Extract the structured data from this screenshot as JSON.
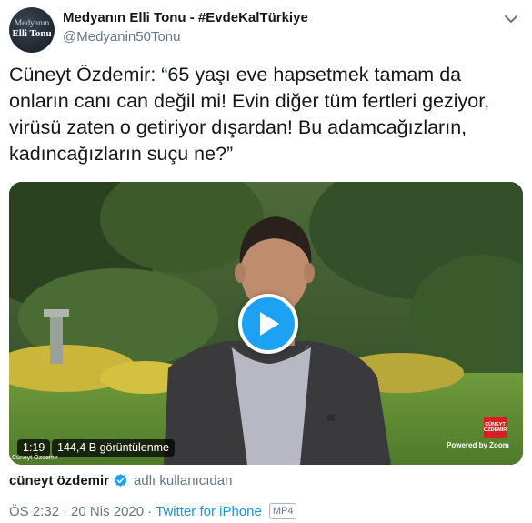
{
  "header": {
    "avatar": {
      "line1": "Medyanın",
      "line2": "Elli Tonu"
    },
    "display_name": "Medyanın Elli Tonu - #EvdeKalTürkiye",
    "handle": "@Medyanin50Tonu",
    "menu_icon": "chevron-down-icon"
  },
  "tweet": {
    "text": "Cüneyt Özdemir: “65 yaşı eve hapsetmek tamam da onların canı can değil mi! Evin diğer tüm fertleri geziyor, virüsü zaten o getiriyor dışardan! Bu adamcağızların, kadıncağızların suçu ne?”"
  },
  "video": {
    "duration": "1:19",
    "views": "144,4 B görüntülenme",
    "watermark_name": "Cüneyt Özdemir",
    "logo_text": "CÜNEYT ÖZDEMİR",
    "powered_by": "Powered by Zoom",
    "play_icon": "play-icon",
    "colors": {
      "play_button": "#1da1f2"
    }
  },
  "source": {
    "name": "cüneyt özdemir",
    "verified_icon": "verified-badge-icon",
    "suffix": "adlı kullanıcıdan"
  },
  "meta": {
    "time": "ÖS 2:32",
    "date": "20 Nis 2020",
    "client": "Twitter for iPhone",
    "format_badge": "MP4"
  },
  "colors": {
    "link": "#1b95e0",
    "secondary_text": "#657786",
    "accent": "#1da1f2"
  }
}
